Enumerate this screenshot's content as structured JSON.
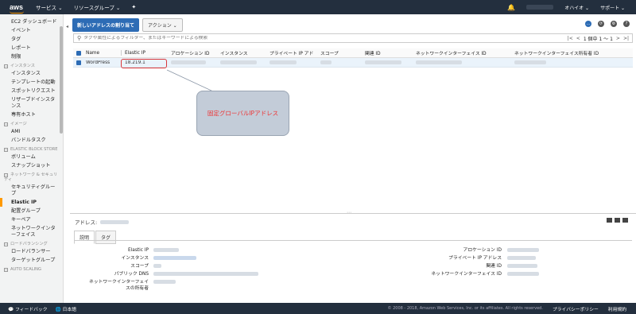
{
  "topnav": {
    "logo": "aws",
    "services": "サービス ⌄",
    "resource_groups": "リソースグループ ⌄",
    "pin": "✦",
    "bell": "🔔",
    "region": "オハイオ ⌄",
    "support": "サポート ⌄"
  },
  "sidebar": {
    "top_items": [
      "EC2 ダッシュボード",
      "イベント",
      "タグ",
      "レポート",
      "制限"
    ],
    "sections": [
      {
        "title": "インスタンス",
        "items": [
          "インスタンス",
          "テンプレートの起動",
          "スポットリクエスト",
          "リザーブドインスタンス",
          "専有ホスト"
        ]
      },
      {
        "title": "イメージ",
        "items": [
          "AMI",
          "バンドルタスク"
        ]
      },
      {
        "title": "ELASTIC BLOCK STORE",
        "items": [
          "ボリューム",
          "スナップショット"
        ]
      },
      {
        "title": "ネットワーク & セキュリティ",
        "items": [
          "セキュリティグループ",
          "Elastic IP",
          "配置グループ",
          "キーペア",
          "ネットワークインターフェイス"
        ]
      },
      {
        "title": "ロードバランシング",
        "items": [
          "ロードバランサー",
          "ターゲットグループ"
        ]
      },
      {
        "title": "AUTO SCALING",
        "items": []
      }
    ],
    "active_item": "Elastic IP"
  },
  "toolbar": {
    "launch_label": "新しいアドレスの割り当て",
    "action_label": "アクション ⌄"
  },
  "search": {
    "placeholder": "タグや属性によるフィルター、またはキーワードによる検索"
  },
  "pager": {
    "count": "1 個中 1 ～ 1"
  },
  "table": {
    "headers": [
      "Name",
      "Elastic IP",
      "アロケーション ID",
      "インスタンス",
      "プライベート IP アド",
      "スコープ",
      "関連 ID",
      "ネットワークインターフェイス ID",
      "ネットワークインターフェイス所有者 ID"
    ],
    "row": {
      "name": "WordPress",
      "elastic_ip": "18.219.1"
    }
  },
  "callout": {
    "text": "固定グローバルIPアドレス"
  },
  "details": {
    "header_label": "アドレス:",
    "tabs": [
      "説明",
      "タグ"
    ],
    "left_keys": [
      "Elastic IP",
      "インスタンス",
      "スコープ",
      "パブリック DNS",
      "ネットワークインターフェイスの所有者"
    ],
    "right_keys": [
      "アロケーション ID",
      "プライベート IP アドレス",
      "関連 ID",
      "ネットワークインターフェイス ID"
    ]
  },
  "footer": {
    "feedback": "フィードバック",
    "language": "日本語",
    "copyright": "© 2008 - 2018, Amazon Web Services, Inc. or its affiliates. All rights reserved.",
    "privacy": "プライバシーポリシー",
    "terms": "利用規約"
  },
  "colors": {
    "nav_bg": "#232f3e",
    "accent": "#ff9900",
    "primary_button": "#2d6cb5",
    "highlight_box": "#d9373a",
    "callout_text": "#ee3333"
  }
}
